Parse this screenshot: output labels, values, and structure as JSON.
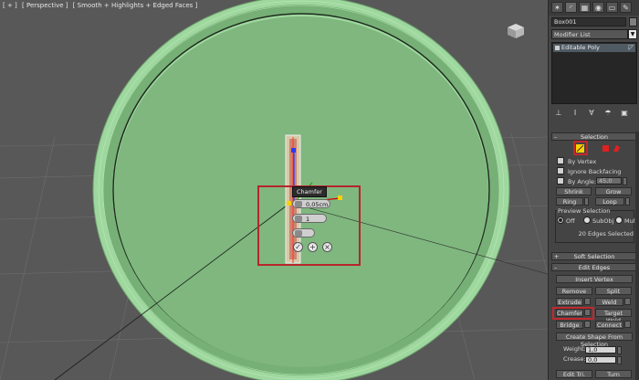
{
  "viewport": {
    "label": [
      "[ + ]",
      "[ Perspective ]",
      "[ Smooth + Highlights + Edged Faces ]"
    ]
  },
  "caddy": {
    "title": "Chamfer",
    "amount": "0,05cm",
    "segments": "1",
    "ok_glyph": "✓",
    "apply_glyph": "+",
    "cancel_glyph": "×"
  },
  "panel": {
    "tabs": [
      "create-icon",
      "modify-icon",
      "hierarchy-icon",
      "motion-icon",
      "display-icon",
      "utilities-icon"
    ],
    "object_name": "Box001",
    "modifier_list": "Modifier List",
    "stack_item": "Editable Poly",
    "selection": {
      "title": "Selection",
      "by_vertex": "By Vertex",
      "ignore_backfacing": "Ignore Backfacing",
      "by_angle": "By Angle:",
      "by_angle_value": "45,0",
      "shrink": "Shrink",
      "grow": "Grow",
      "ring": "Ring",
      "loop": "Loop",
      "preview_title": "Preview Selection",
      "preview_off": "Off",
      "preview_subobj": "SubObj",
      "preview_multi": "Multi",
      "status": "20 Edges Selected"
    },
    "soft_selection": "Soft Selection",
    "edit_edges": {
      "title": "Edit Edges",
      "insert_vertex": "Insert Vertex",
      "remove": "Remove",
      "split": "Split",
      "extrude": "Extrude",
      "weld": "Weld",
      "chamfer": "Chamfer",
      "target_weld": "Target Weld",
      "bridge": "Bridge",
      "connect": "Connect",
      "create_shape": "Create Shape From Selection",
      "weight_label": "Weight:",
      "weight_value": "1,0",
      "crease_label": "Crease:",
      "crease_value": "0,0",
      "edit_tri": "Edit Tri.",
      "turn": "Turn"
    }
  },
  "colors": {
    "disc": "#7fb77f",
    "highlight": "#c0292f",
    "viewport_bg": "#585858"
  }
}
